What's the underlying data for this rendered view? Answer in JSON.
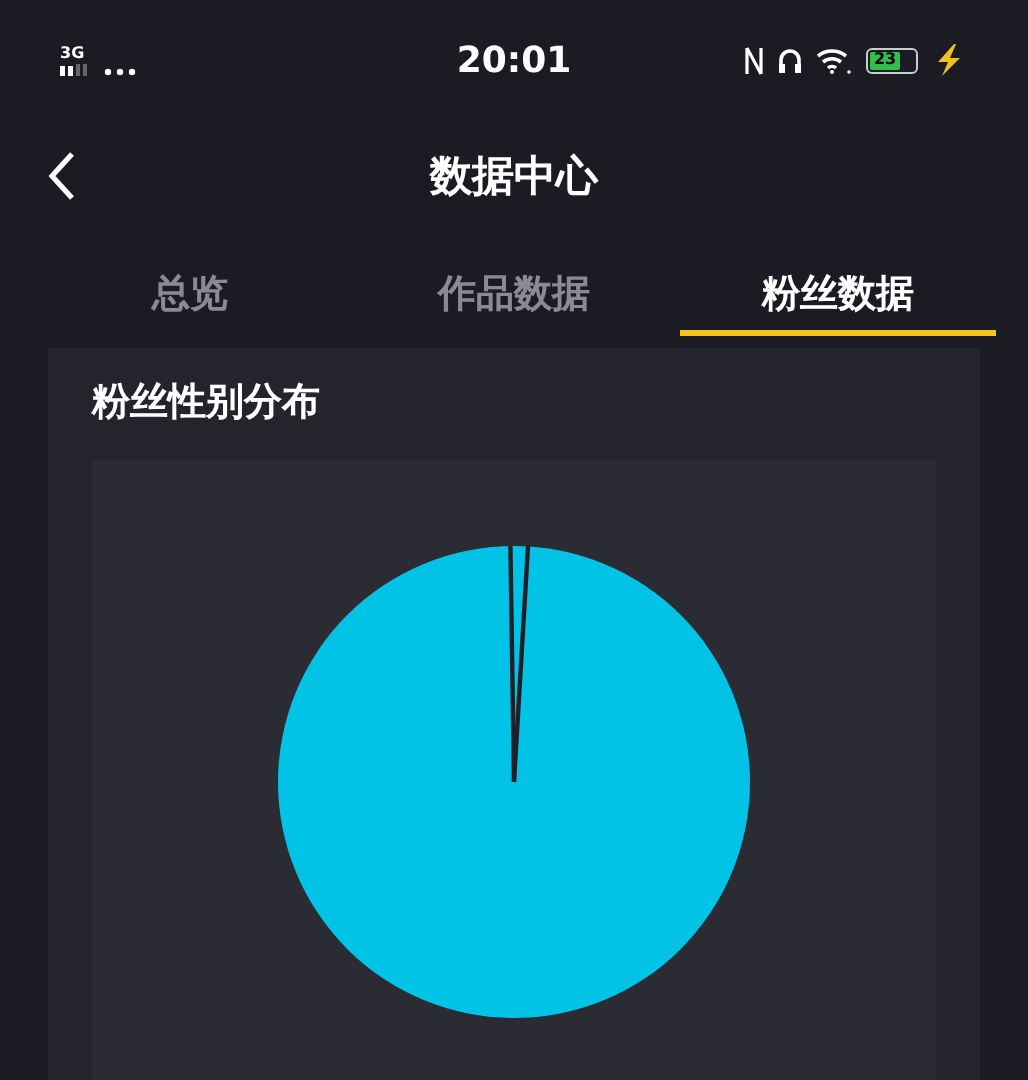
{
  "status_bar": {
    "network": "3G",
    "time": "20:01",
    "battery": "23"
  },
  "header": {
    "title": "数据中心"
  },
  "tabs": [
    {
      "label": "总览",
      "selected": false
    },
    {
      "label": "作品数据",
      "selected": false
    },
    {
      "label": "粉丝数据",
      "selected": true
    }
  ],
  "card": {
    "title": "粉丝性别分布"
  }
}
